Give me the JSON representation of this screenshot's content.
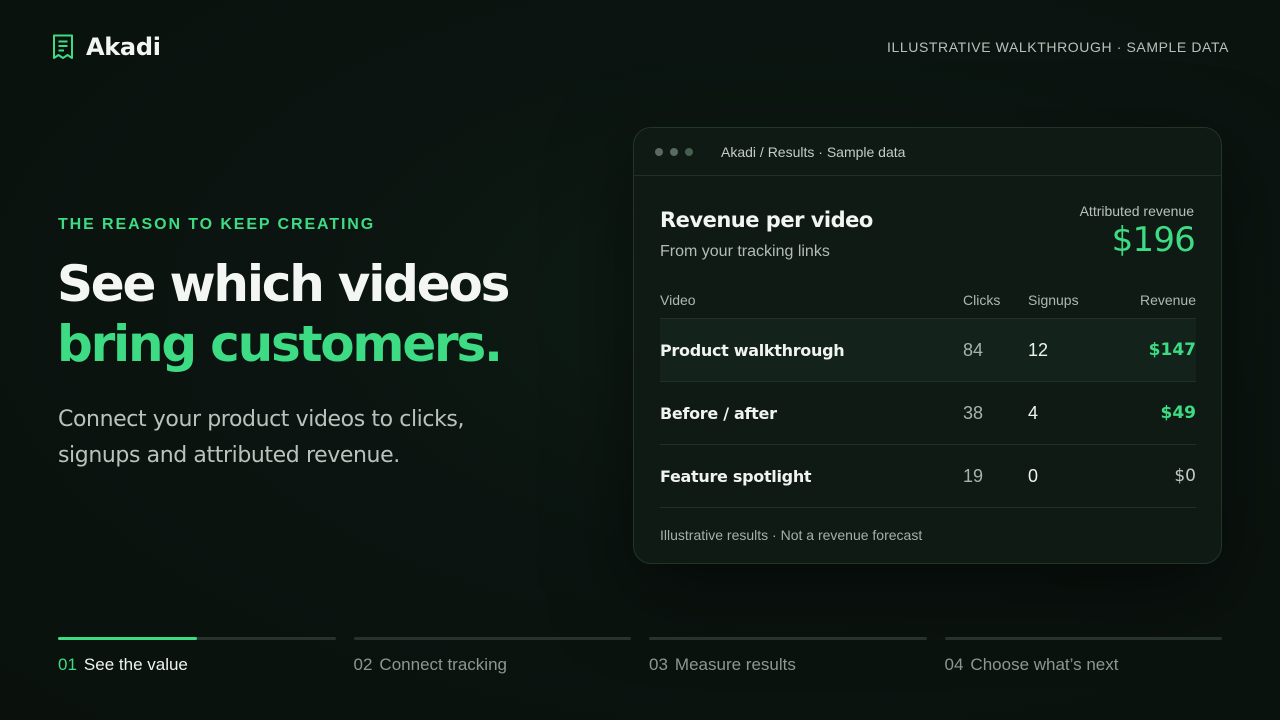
{
  "brand": {
    "name": "Akadi",
    "icon": "receipt-icon"
  },
  "top_tag": "ILLUSTRATIVE WALKTHROUGH · SAMPLE DATA",
  "hero": {
    "eyebrow": "THE REASON TO KEEP CREATING",
    "headline_line1": "See which videos",
    "headline_line2": "bring customers.",
    "subcopy": "Connect your product videos to clicks, signups and attributed revenue."
  },
  "card": {
    "breadcrumb": "Akadi / Results · Sample data",
    "title": "Revenue per video",
    "subtitle": "From your tracking links",
    "attributed_label": "Attributed revenue",
    "attributed_value": "$196",
    "columns": [
      "Video",
      "Clicks",
      "Signups",
      "Revenue"
    ],
    "rows": [
      {
        "video": "Product walkthrough",
        "clicks": "84",
        "signups": "12",
        "revenue": "$147"
      },
      {
        "video": "Before / after",
        "clicks": "38",
        "signups": "4",
        "revenue": "$49"
      },
      {
        "video": "Feature spotlight",
        "clicks": "19",
        "signups": "0",
        "revenue": "$0"
      }
    ],
    "footnote": "Illustrative results · Not a revenue forecast"
  },
  "steps": [
    {
      "num": "01",
      "label": "See the value",
      "progress": 0.5
    },
    {
      "num": "02",
      "label": "Connect tracking",
      "progress": 0
    },
    {
      "num": "03",
      "label": "Measure results",
      "progress": 0
    },
    {
      "num": "04",
      "label": "Choose what’s next",
      "progress": 0
    }
  ],
  "colors": {
    "accent": "#3ddc84",
    "background": "#0a110d",
    "card": "#0f1a14"
  }
}
